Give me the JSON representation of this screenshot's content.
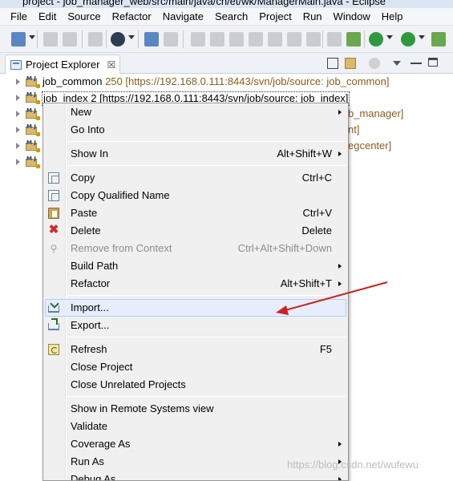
{
  "window": {
    "title": "project - job_manager_web/src/main/java/cn/et/wk/ManagerMain.java - Eclipse"
  },
  "menubar": {
    "items": [
      "File",
      "Edit",
      "Source",
      "Refactor",
      "Navigate",
      "Search",
      "Project",
      "Run",
      "Window",
      "Help"
    ]
  },
  "view": {
    "tab_label": "Project Explorer",
    "tab_close": "☒"
  },
  "tree": {
    "rows": [
      {
        "name": "job_common",
        "svn": "250 [https://192.168.0.111:8443/svn/job/source: job_common]"
      },
      {
        "name": "job_index 2",
        "svn": "[https://192.168.0.111:8443/svn/job/source: job_index]"
      },
      {
        "name": "",
        "svn": "b_manager]"
      },
      {
        "name": "",
        "svn": "nt]"
      },
      {
        "name": "",
        "svn": "egcenter]"
      },
      {
        "name": "",
        "svn": ""
      }
    ]
  },
  "context_menu": {
    "new": {
      "label": "New"
    },
    "go_into": {
      "label": "Go Into"
    },
    "show_in": {
      "label": "Show In",
      "shortcut": "Alt+Shift+W"
    },
    "copy": {
      "label": "Copy",
      "shortcut": "Ctrl+C"
    },
    "copy_qualified": {
      "label": "Copy Qualified Name"
    },
    "paste": {
      "label": "Paste",
      "shortcut": "Ctrl+V"
    },
    "delete": {
      "label": "Delete",
      "shortcut": "Delete"
    },
    "remove_context": {
      "label": "Remove from Context",
      "shortcut": "Ctrl+Alt+Shift+Down"
    },
    "build_path": {
      "label": "Build Path"
    },
    "refactor": {
      "label": "Refactor",
      "shortcut": "Alt+Shift+T"
    },
    "import": {
      "label": "Import..."
    },
    "export": {
      "label": "Export..."
    },
    "refresh": {
      "label": "Refresh",
      "shortcut": "F5"
    },
    "close_project": {
      "label": "Close Project"
    },
    "close_unrelated": {
      "label": "Close Unrelated Projects"
    },
    "show_remote": {
      "label": "Show in Remote Systems view"
    },
    "validate": {
      "label": "Validate"
    },
    "coverage_as": {
      "label": "Coverage As"
    },
    "run_as": {
      "label": "Run As"
    },
    "debug_as": {
      "label": "Debug As"
    }
  },
  "annotation": {
    "arrow_color": "#cc2222"
  },
  "watermark": "https://blog.csdn.net/wufewu",
  "colors": {
    "menu_bg": "#f0f0f0",
    "hover_bg": "#e5eefa",
    "svn_text": "#8a5d1a"
  }
}
